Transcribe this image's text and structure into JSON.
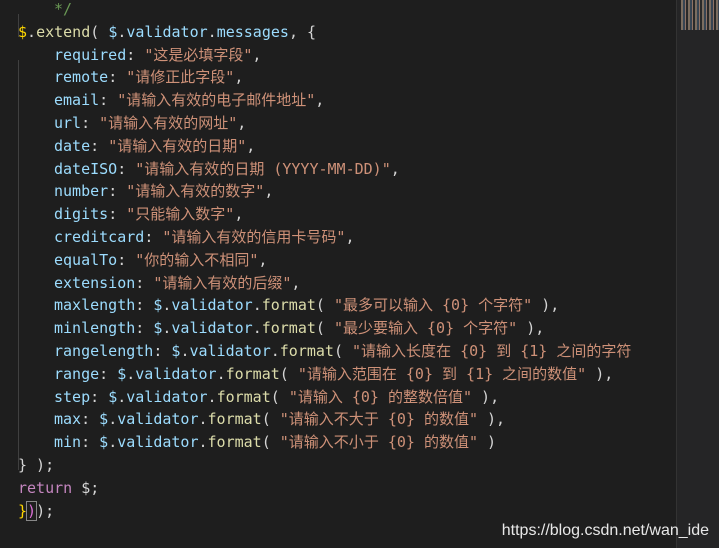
{
  "code": {
    "comment_close": "*/",
    "extend_head": [
      "$",
      ".",
      "extend",
      "( ",
      "$",
      ".",
      "validator",
      ".",
      "messages",
      ", {"
    ],
    "simple_entries": [
      {
        "key": "required",
        "value": "\"这是必填字段\""
      },
      {
        "key": "remote",
        "value": "\"请修正此字段\""
      },
      {
        "key": "email",
        "value": "\"请输入有效的电子邮件地址\""
      },
      {
        "key": "url",
        "value": "\"请输入有效的网址\""
      },
      {
        "key": "date",
        "value": "\"请输入有效的日期\""
      },
      {
        "key": "dateISO",
        "value": "\"请输入有效的日期 (YYYY-MM-DD)\""
      },
      {
        "key": "number",
        "value": "\"请输入有效的数字\""
      },
      {
        "key": "digits",
        "value": "\"只能输入数字\""
      },
      {
        "key": "creditcard",
        "value": "\"请输入有效的信用卡号码\""
      },
      {
        "key": "equalTo",
        "value": "\"你的输入不相同\""
      },
      {
        "key": "extension",
        "value": "\"请输入有效的后缀\""
      }
    ],
    "format_entries": [
      {
        "key": "maxlength",
        "value": "\"最多可以输入 {0} 个字符\"",
        "tail": " ),"
      },
      {
        "key": "minlength",
        "value": "\"最少要输入 {0} 个字符\"",
        "tail": " ),"
      },
      {
        "key": "rangelength",
        "value": "\"请输入长度在 {0} 到 {1} 之间的字符",
        "tail": ""
      },
      {
        "key": "range",
        "value": "\"请输入范围在 {0} 到 {1} 之间的数值\"",
        "tail": " ),"
      },
      {
        "key": "step",
        "value": "\"请输入 {0} 的整数倍值\"",
        "tail": " ),"
      },
      {
        "key": "max",
        "value": "\"请输入不大于 {0} 的数值\"",
        "tail": " ),"
      },
      {
        "key": "min",
        "value": "\"请输入不小于 {0} 的数值\"",
        "tail": " )"
      }
    ],
    "format_call": [
      "$",
      ".",
      "validator",
      ".",
      "format",
      "( "
    ],
    "close_extend": "} );",
    "return_kw": "return",
    "return_val": " $;",
    "final_line": [
      "}",
      ")",
      ");"
    ]
  },
  "watermark": "https://blog.csdn.net/wan_ide"
}
